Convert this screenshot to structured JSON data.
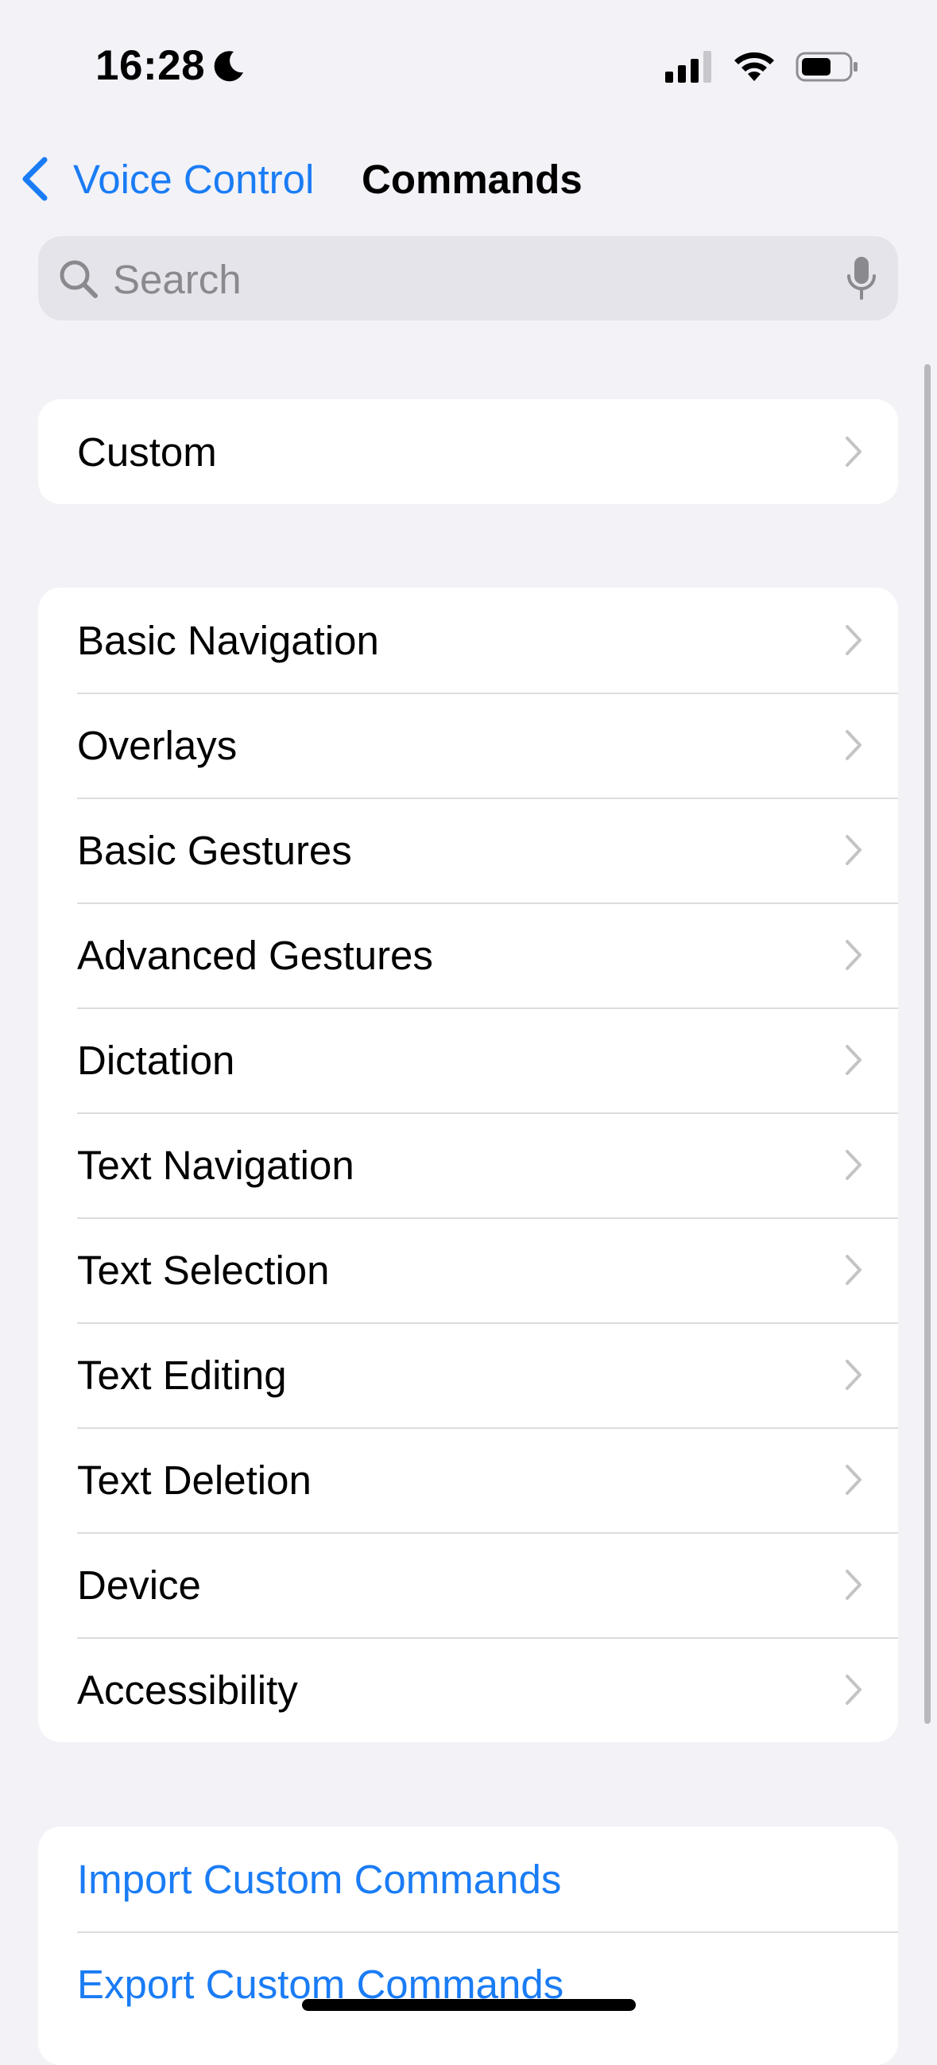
{
  "status_bar": {
    "time": "16:28",
    "focus_icon": "moon-icon",
    "signal_icon": "cellular-signal-icon",
    "wifi_icon": "wifi-icon",
    "battery_icon": "battery-icon"
  },
  "nav": {
    "back_label": "Voice Control",
    "title": "Commands"
  },
  "search": {
    "placeholder": "Search",
    "value": ""
  },
  "groups": {
    "custom": [
      {
        "label": "Custom"
      }
    ],
    "categories": [
      {
        "label": "Basic Navigation"
      },
      {
        "label": "Overlays"
      },
      {
        "label": "Basic Gestures"
      },
      {
        "label": "Advanced Gestures"
      },
      {
        "label": "Dictation"
      },
      {
        "label": "Text Navigation"
      },
      {
        "label": "Text Selection"
      },
      {
        "label": "Text Editing"
      },
      {
        "label": "Text Deletion"
      },
      {
        "label": "Device"
      },
      {
        "label": "Accessibility"
      }
    ],
    "actions": [
      {
        "label": "Import Custom Commands"
      },
      {
        "label": "Export Custom Commands"
      }
    ]
  },
  "colors": {
    "accent": "#1a7cf5",
    "background": "#f2f2f7",
    "card": "#ffffff"
  }
}
